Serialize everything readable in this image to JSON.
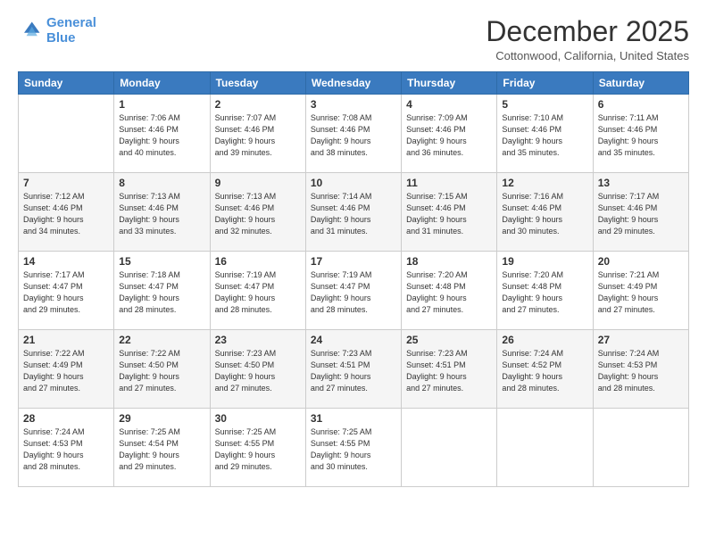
{
  "logo": {
    "line1": "General",
    "line2": "Blue"
  },
  "title": "December 2025",
  "location": "Cottonwood, California, United States",
  "days_header": [
    "Sunday",
    "Monday",
    "Tuesday",
    "Wednesday",
    "Thursday",
    "Friday",
    "Saturday"
  ],
  "weeks": [
    [
      {
        "day": "",
        "info": ""
      },
      {
        "day": "1",
        "info": "Sunrise: 7:06 AM\nSunset: 4:46 PM\nDaylight: 9 hours\nand 40 minutes."
      },
      {
        "day": "2",
        "info": "Sunrise: 7:07 AM\nSunset: 4:46 PM\nDaylight: 9 hours\nand 39 minutes."
      },
      {
        "day": "3",
        "info": "Sunrise: 7:08 AM\nSunset: 4:46 PM\nDaylight: 9 hours\nand 38 minutes."
      },
      {
        "day": "4",
        "info": "Sunrise: 7:09 AM\nSunset: 4:46 PM\nDaylight: 9 hours\nand 36 minutes."
      },
      {
        "day": "5",
        "info": "Sunrise: 7:10 AM\nSunset: 4:46 PM\nDaylight: 9 hours\nand 35 minutes."
      },
      {
        "day": "6",
        "info": "Sunrise: 7:11 AM\nSunset: 4:46 PM\nDaylight: 9 hours\nand 35 minutes."
      }
    ],
    [
      {
        "day": "7",
        "info": "Sunrise: 7:12 AM\nSunset: 4:46 PM\nDaylight: 9 hours\nand 34 minutes."
      },
      {
        "day": "8",
        "info": "Sunrise: 7:13 AM\nSunset: 4:46 PM\nDaylight: 9 hours\nand 33 minutes."
      },
      {
        "day": "9",
        "info": "Sunrise: 7:13 AM\nSunset: 4:46 PM\nDaylight: 9 hours\nand 32 minutes."
      },
      {
        "day": "10",
        "info": "Sunrise: 7:14 AM\nSunset: 4:46 PM\nDaylight: 9 hours\nand 31 minutes."
      },
      {
        "day": "11",
        "info": "Sunrise: 7:15 AM\nSunset: 4:46 PM\nDaylight: 9 hours\nand 31 minutes."
      },
      {
        "day": "12",
        "info": "Sunrise: 7:16 AM\nSunset: 4:46 PM\nDaylight: 9 hours\nand 30 minutes."
      },
      {
        "day": "13",
        "info": "Sunrise: 7:17 AM\nSunset: 4:46 PM\nDaylight: 9 hours\nand 29 minutes."
      }
    ],
    [
      {
        "day": "14",
        "info": "Sunrise: 7:17 AM\nSunset: 4:47 PM\nDaylight: 9 hours\nand 29 minutes."
      },
      {
        "day": "15",
        "info": "Sunrise: 7:18 AM\nSunset: 4:47 PM\nDaylight: 9 hours\nand 28 minutes."
      },
      {
        "day": "16",
        "info": "Sunrise: 7:19 AM\nSunset: 4:47 PM\nDaylight: 9 hours\nand 28 minutes."
      },
      {
        "day": "17",
        "info": "Sunrise: 7:19 AM\nSunset: 4:47 PM\nDaylight: 9 hours\nand 28 minutes."
      },
      {
        "day": "18",
        "info": "Sunrise: 7:20 AM\nSunset: 4:48 PM\nDaylight: 9 hours\nand 27 minutes."
      },
      {
        "day": "19",
        "info": "Sunrise: 7:20 AM\nSunset: 4:48 PM\nDaylight: 9 hours\nand 27 minutes."
      },
      {
        "day": "20",
        "info": "Sunrise: 7:21 AM\nSunset: 4:49 PM\nDaylight: 9 hours\nand 27 minutes."
      }
    ],
    [
      {
        "day": "21",
        "info": "Sunrise: 7:22 AM\nSunset: 4:49 PM\nDaylight: 9 hours\nand 27 minutes."
      },
      {
        "day": "22",
        "info": "Sunrise: 7:22 AM\nSunset: 4:50 PM\nDaylight: 9 hours\nand 27 minutes."
      },
      {
        "day": "23",
        "info": "Sunrise: 7:23 AM\nSunset: 4:50 PM\nDaylight: 9 hours\nand 27 minutes."
      },
      {
        "day": "24",
        "info": "Sunrise: 7:23 AM\nSunset: 4:51 PM\nDaylight: 9 hours\nand 27 minutes."
      },
      {
        "day": "25",
        "info": "Sunrise: 7:23 AM\nSunset: 4:51 PM\nDaylight: 9 hours\nand 27 minutes."
      },
      {
        "day": "26",
        "info": "Sunrise: 7:24 AM\nSunset: 4:52 PM\nDaylight: 9 hours\nand 28 minutes."
      },
      {
        "day": "27",
        "info": "Sunrise: 7:24 AM\nSunset: 4:53 PM\nDaylight: 9 hours\nand 28 minutes."
      }
    ],
    [
      {
        "day": "28",
        "info": "Sunrise: 7:24 AM\nSunset: 4:53 PM\nDaylight: 9 hours\nand 28 minutes."
      },
      {
        "day": "29",
        "info": "Sunrise: 7:25 AM\nSunset: 4:54 PM\nDaylight: 9 hours\nand 29 minutes."
      },
      {
        "day": "30",
        "info": "Sunrise: 7:25 AM\nSunset: 4:55 PM\nDaylight: 9 hours\nand 29 minutes."
      },
      {
        "day": "31",
        "info": "Sunrise: 7:25 AM\nSunset: 4:55 PM\nDaylight: 9 hours\nand 30 minutes."
      },
      {
        "day": "",
        "info": ""
      },
      {
        "day": "",
        "info": ""
      },
      {
        "day": "",
        "info": ""
      }
    ]
  ]
}
